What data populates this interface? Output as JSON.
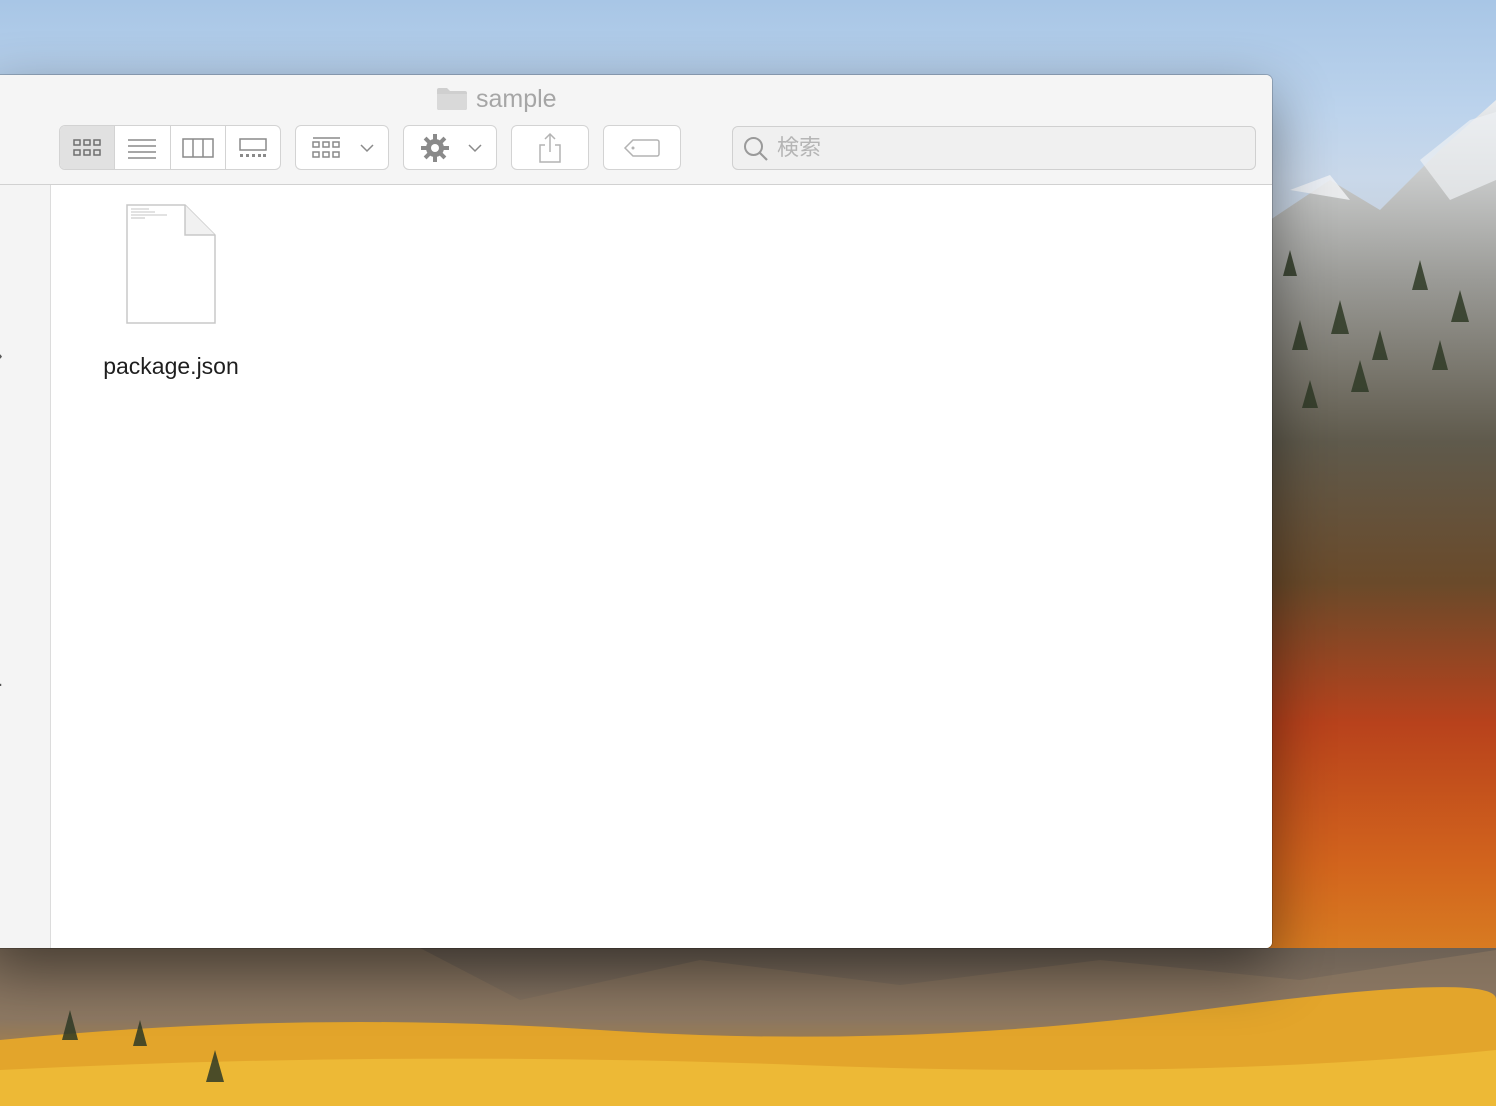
{
  "window": {
    "title": "sample",
    "title_icon": "folder-icon"
  },
  "toolbar": {
    "view_modes": [
      {
        "name": "icon-view",
        "icon": "grid-icon",
        "selected": true
      },
      {
        "name": "list-view",
        "icon": "list-icon",
        "selected": false
      },
      {
        "name": "column-view",
        "icon": "columns-icon",
        "selected": false
      },
      {
        "name": "gallery-view",
        "icon": "gallery-icon",
        "selected": false
      }
    ],
    "group_by_icon": "group-grid-icon",
    "action_icon": "gear-icon",
    "share_icon": "share-icon",
    "tags_icon": "tag-icon"
  },
  "search": {
    "placeholder": "検索",
    "value": ""
  },
  "sidebar": {
    "fragment_1": "›",
    "fragment_2": ".."
  },
  "files": [
    {
      "name": "package.json",
      "icon": "document-icon"
    }
  ],
  "colors": {
    "toolbar_bg": "#f5f5f5",
    "accent_inactive": "#a6a6a6"
  }
}
